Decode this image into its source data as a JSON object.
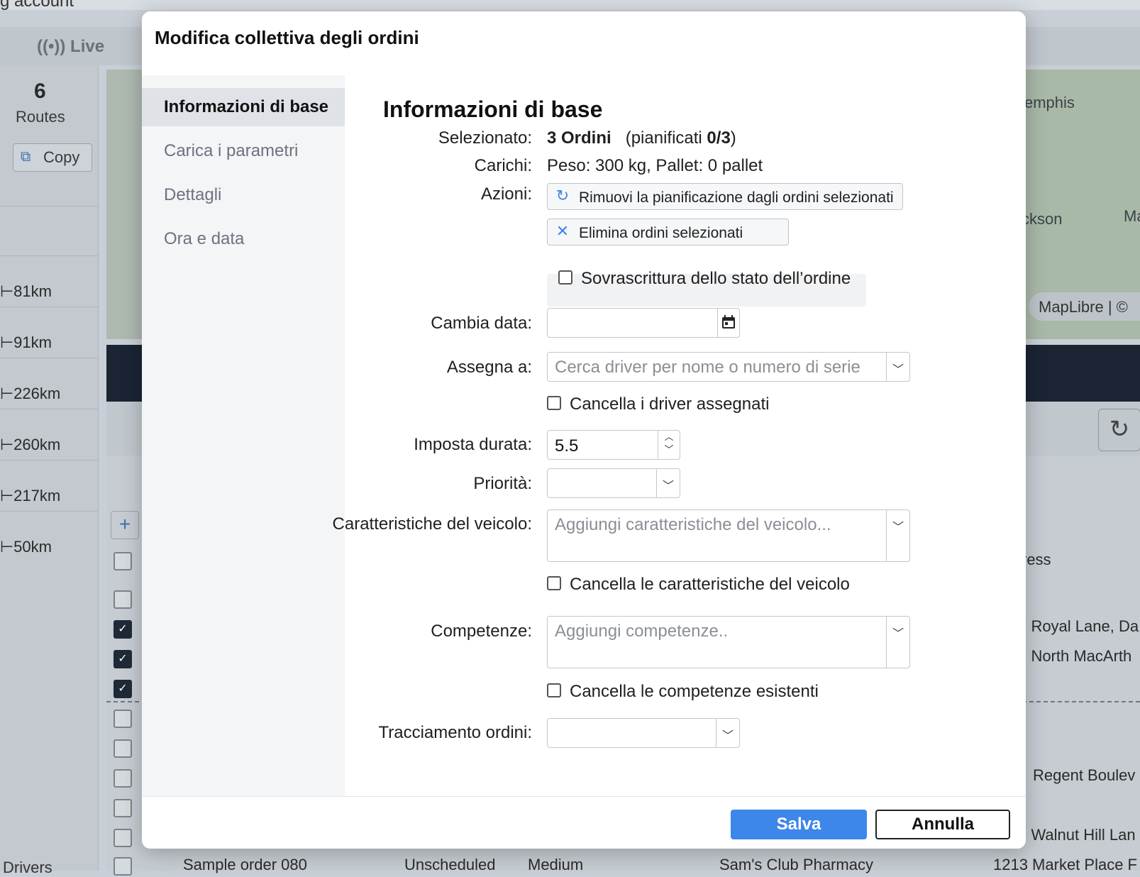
{
  "background": {
    "account_text": "g account",
    "live_label": "Live",
    "routes_count": "6",
    "routes_label": "Routes",
    "copy_label": "Copy",
    "distances": [
      "81km",
      "91km",
      "226km",
      "260km",
      "217km",
      "50km"
    ],
    "map_labels": [
      "emphis",
      "ckson",
      "Ma"
    ],
    "map_attribution": "MapLibre | ©",
    "table_column_partial": "ress",
    "addresses": [
      ") Royal Lane, Da",
      ") North MacArth",
      "Regent Boulev",
      ") Walnut Hill Lan",
      "1213 Market Place F"
    ],
    "bottom_row": {
      "name": "Sample order 080",
      "status": "Unscheduled",
      "priority": "Medium",
      "customer": "Sam's Club Pharmacy"
    },
    "drivers_label": "Drivers"
  },
  "modal": {
    "title": "Modifica collettiva degli ordini",
    "sidebar": [
      {
        "label": "Informazioni di base",
        "active": true
      },
      {
        "label": "Carica i parametri",
        "active": false
      },
      {
        "label": "Dettagli",
        "active": false
      },
      {
        "label": "Ora e data",
        "active": false
      }
    ],
    "section_title": "Informazioni di base",
    "selected": {
      "label": "Selezionato:",
      "count": "3 Ordini",
      "scheduled_prefix": "(pianificati ",
      "scheduled_value": "0/3",
      "scheduled_suffix": ")"
    },
    "loads": {
      "label": "Carichi:",
      "value": "Peso: 300 kg,  Pallet: 0 pallet"
    },
    "actions": {
      "label": "Azioni:",
      "unschedule": "Rimuovi la pianificazione dagli ordini selezionati",
      "delete": "Elimina ordini selezionati"
    },
    "override_status": {
      "label": "Sovrascrittura dello stato dell’ordine",
      "checked": false
    },
    "change_date": {
      "label": "Cambia data:",
      "value": ""
    },
    "assign_to": {
      "label": "Assegna a:",
      "placeholder": "Cerca driver per nome o numero di serie"
    },
    "clear_drivers": {
      "label": "Cancella i driver assegnati",
      "checked": false
    },
    "duration": {
      "label": "Imposta durata:",
      "value": "5.5"
    },
    "priority": {
      "label": "Priorità:",
      "value": ""
    },
    "vehicle_features": {
      "label": "Caratteristiche del veicolo:",
      "placeholder": "Aggiungi caratteristiche del veicolo..."
    },
    "clear_vehicle_features": {
      "label": "Cancella le caratteristiche del veicolo",
      "checked": false
    },
    "skills": {
      "label": "Competenze:",
      "placeholder": "Aggiungi competenze.."
    },
    "clear_skills": {
      "label": "Cancella le competenze esistenti",
      "checked": false
    },
    "order_tracking": {
      "label": "Tracciamento ordini:",
      "value": ""
    },
    "footer": {
      "save": "Salva",
      "cancel": "Annulla"
    }
  },
  "colors": {
    "primary": "#3d86ea",
    "sidebar_active": "#dfe2e7"
  }
}
